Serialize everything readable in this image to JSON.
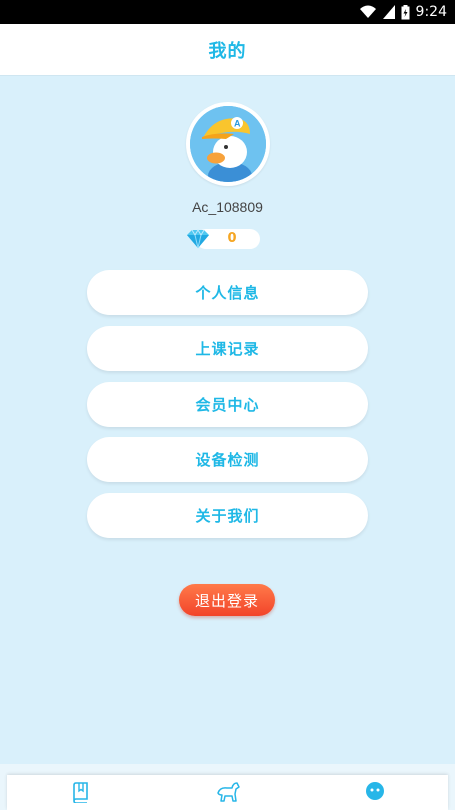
{
  "status_bar": {
    "time": "9:24"
  },
  "header": {
    "title": "我的"
  },
  "profile": {
    "username": "Ac_108809",
    "diamonds": "0"
  },
  "menu": [
    {
      "label": "个人信息"
    },
    {
      "label": "上课记录"
    },
    {
      "label": "会员中心"
    },
    {
      "label": "设备检测"
    },
    {
      "label": "关于我们"
    }
  ],
  "logout": {
    "label": "退出登录"
  },
  "bottom_nav": [
    {
      "icon": "book-icon"
    },
    {
      "icon": "horse-icon"
    },
    {
      "icon": "face-icon",
      "active": true
    }
  ],
  "colors": {
    "accent": "#1fb8e6",
    "background": "#d9f0fb",
    "diamond_count": "#f5a623",
    "logout": "#f2442a"
  }
}
